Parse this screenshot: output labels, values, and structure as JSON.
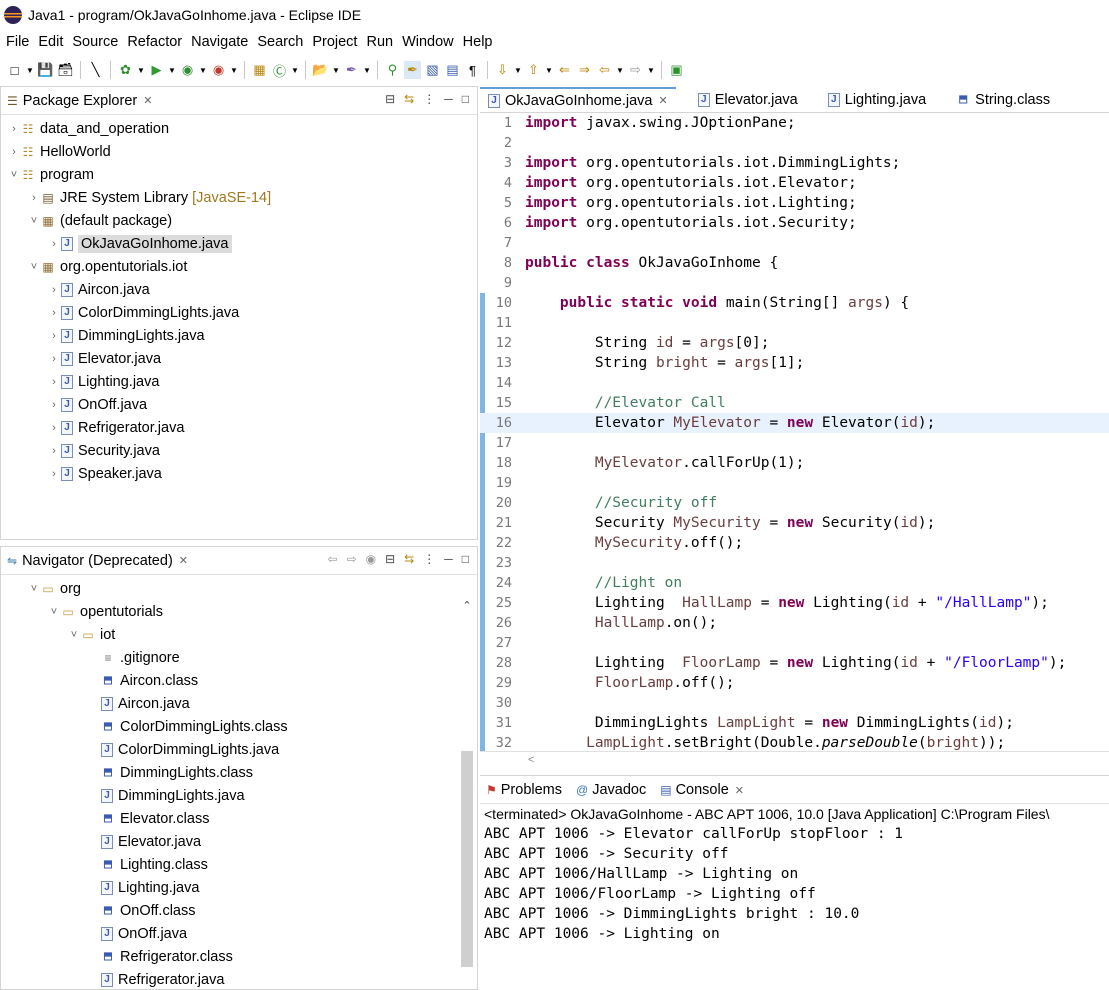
{
  "window": {
    "title": "Java1 - program/OkJavaGoInhome.java - Eclipse IDE"
  },
  "menu": [
    "File",
    "Edit",
    "Source",
    "Refactor",
    "Navigate",
    "Search",
    "Project",
    "Run",
    "Window",
    "Help"
  ],
  "package_explorer": {
    "title": "Package Explorer",
    "items": [
      {
        "label": "data_and_operation",
        "kind": "project",
        "expanded": false,
        "level": 0
      },
      {
        "label": "HelloWorld",
        "kind": "project",
        "expanded": false,
        "level": 0
      },
      {
        "label": "program",
        "kind": "project",
        "expanded": true,
        "level": 0
      },
      {
        "label": "JRE System Library",
        "decoration": "[JavaSE-14]",
        "kind": "library",
        "expanded": false,
        "level": 1
      },
      {
        "label": "(default package)",
        "kind": "package",
        "expanded": true,
        "level": 1
      },
      {
        "label": "OkJavaGoInhome.java",
        "kind": "java",
        "expanded": false,
        "level": 2,
        "selected": true
      },
      {
        "label": "org.opentutorials.iot",
        "kind": "package",
        "expanded": true,
        "level": 1
      },
      {
        "label": "Aircon.java",
        "kind": "java",
        "expanded": false,
        "level": 2
      },
      {
        "label": "ColorDimmingLights.java",
        "kind": "java",
        "expanded": false,
        "level": 2
      },
      {
        "label": "DimmingLights.java",
        "kind": "java",
        "expanded": false,
        "level": 2
      },
      {
        "label": "Elevator.java",
        "kind": "java",
        "expanded": false,
        "level": 2
      },
      {
        "label": "Lighting.java",
        "kind": "java",
        "expanded": false,
        "level": 2
      },
      {
        "label": "OnOff.java",
        "kind": "java",
        "expanded": false,
        "level": 2
      },
      {
        "label": "Refrigerator.java",
        "kind": "java",
        "expanded": false,
        "level": 2
      },
      {
        "label": "Security.java",
        "kind": "java",
        "expanded": false,
        "level": 2
      },
      {
        "label": "Speaker.java",
        "kind": "java",
        "expanded": false,
        "level": 2
      }
    ]
  },
  "navigator": {
    "title": "Navigator (Deprecated)",
    "items": [
      {
        "label": "org",
        "kind": "folder",
        "level": 0,
        "expanded": true
      },
      {
        "label": "opentutorials",
        "kind": "folder",
        "level": 1,
        "expanded": true
      },
      {
        "label": "iot",
        "kind": "folder",
        "level": 2,
        "expanded": true
      },
      {
        "label": ".gitignore",
        "kind": "file",
        "level": 3
      },
      {
        "label": "Aircon.class",
        "kind": "class",
        "level": 3
      },
      {
        "label": "Aircon.java",
        "kind": "java",
        "level": 3
      },
      {
        "label": "ColorDimmingLights.class",
        "kind": "class",
        "level": 3
      },
      {
        "label": "ColorDimmingLights.java",
        "kind": "java",
        "level": 3
      },
      {
        "label": "DimmingLights.class",
        "kind": "class",
        "level": 3
      },
      {
        "label": "DimmingLights.java",
        "kind": "java",
        "level": 3
      },
      {
        "label": "Elevator.class",
        "kind": "class",
        "level": 3
      },
      {
        "label": "Elevator.java",
        "kind": "java",
        "level": 3
      },
      {
        "label": "Lighting.class",
        "kind": "class",
        "level": 3
      },
      {
        "label": "Lighting.java",
        "kind": "java",
        "level": 3
      },
      {
        "label": "OnOff.class",
        "kind": "class",
        "level": 3
      },
      {
        "label": "OnOff.java",
        "kind": "java",
        "level": 3
      },
      {
        "label": "Refrigerator.class",
        "kind": "class",
        "level": 3
      },
      {
        "label": "Refrigerator.java",
        "kind": "java",
        "level": 3
      }
    ]
  },
  "editor": {
    "tabs": [
      {
        "label": "OkJavaGoInhome.java",
        "active": true
      },
      {
        "label": "Elevator.java",
        "active": false
      },
      {
        "label": "Lighting.java",
        "active": false
      },
      {
        "label": "String.class",
        "active": false
      }
    ],
    "lines": [
      {
        "n": "1",
        "code": "import javax.swing.JOptionPane;"
      },
      {
        "n": "2",
        "code": ""
      },
      {
        "n": "3",
        "code": "import org.opentutorials.iot.DimmingLights;"
      },
      {
        "n": "4",
        "code": "import org.opentutorials.iot.Elevator;"
      },
      {
        "n": "5",
        "code": "import org.opentutorials.iot.Lighting;"
      },
      {
        "n": "6",
        "code": "import org.opentutorials.iot.Security;"
      },
      {
        "n": "7",
        "code": ""
      },
      {
        "n": "8",
        "code": "public class OkJavaGoInhome {"
      },
      {
        "n": "9",
        "code": ""
      },
      {
        "n": "10",
        "code": "    public static void main(String[] args) {"
      },
      {
        "n": "11",
        "code": ""
      },
      {
        "n": "12",
        "code": "        String id = args[0];"
      },
      {
        "n": "13",
        "code": "        String bright = args[1];"
      },
      {
        "n": "14",
        "code": ""
      },
      {
        "n": "15",
        "code": "        //Elevator Call"
      },
      {
        "n": "16",
        "code": "        Elevator MyElevator = new Elevator(id);"
      },
      {
        "n": "17",
        "code": ""
      },
      {
        "n": "18",
        "code": "        MyElevator.callForUp(1);"
      },
      {
        "n": "19",
        "code": ""
      },
      {
        "n": "20",
        "code": "        //Security off"
      },
      {
        "n": "21",
        "code": "        Security MySecurity = new Security(id);"
      },
      {
        "n": "22",
        "code": "        MySecurity.off();"
      },
      {
        "n": "23",
        "code": ""
      },
      {
        "n": "24",
        "code": "        //Light on"
      },
      {
        "n": "25",
        "code": "        Lighting  HallLamp = new Lighting(id + \"/HallLamp\");"
      },
      {
        "n": "26",
        "code": "        HallLamp.on();"
      },
      {
        "n": "27",
        "code": ""
      },
      {
        "n": "28",
        "code": "        Lighting  FloorLamp = new Lighting(id + \"/FloorLamp\");"
      },
      {
        "n": "29",
        "code": "        FloorLamp.off();"
      },
      {
        "n": "30",
        "code": ""
      },
      {
        "n": "31",
        "code": "        DimmingLights LampLight = new DimmingLights(id);"
      },
      {
        "n": "32",
        "code": "       LampLight.setBright(Double.parseDouble(bright));"
      }
    ],
    "current_line": "16"
  },
  "bottom_tabs": [
    {
      "label": "Problems",
      "active": false
    },
    {
      "label": "Javadoc",
      "active": false
    },
    {
      "label": "Console",
      "active": true
    }
  ],
  "console": {
    "terminated": "<terminated> OkJavaGoInhome - ABC APT 1006, 10.0 [Java Application] C:\\Program Files\\",
    "lines": [
      "ABC APT 1006 -> Elevator callForUp stopFloor : 1",
      "ABC APT 1006 -> Security off",
      "ABC APT 1006/HallLamp -> Lighting on",
      "ABC APT 1006/FloorLamp -> Lighting off",
      "ABC APT 1006 -> DimmingLights bright : 10.0",
      "ABC APT 1006 -> Lighting on"
    ]
  },
  "colors": {
    "keyword": "#7f0055",
    "comment": "#3f7f5f",
    "string": "#2a00ff",
    "field": "#6a3e3e",
    "current_line_bg": "#e8f2fe",
    "selection_bg": "#dcdcdc",
    "active_tab_accent": "#5f9fdc"
  }
}
